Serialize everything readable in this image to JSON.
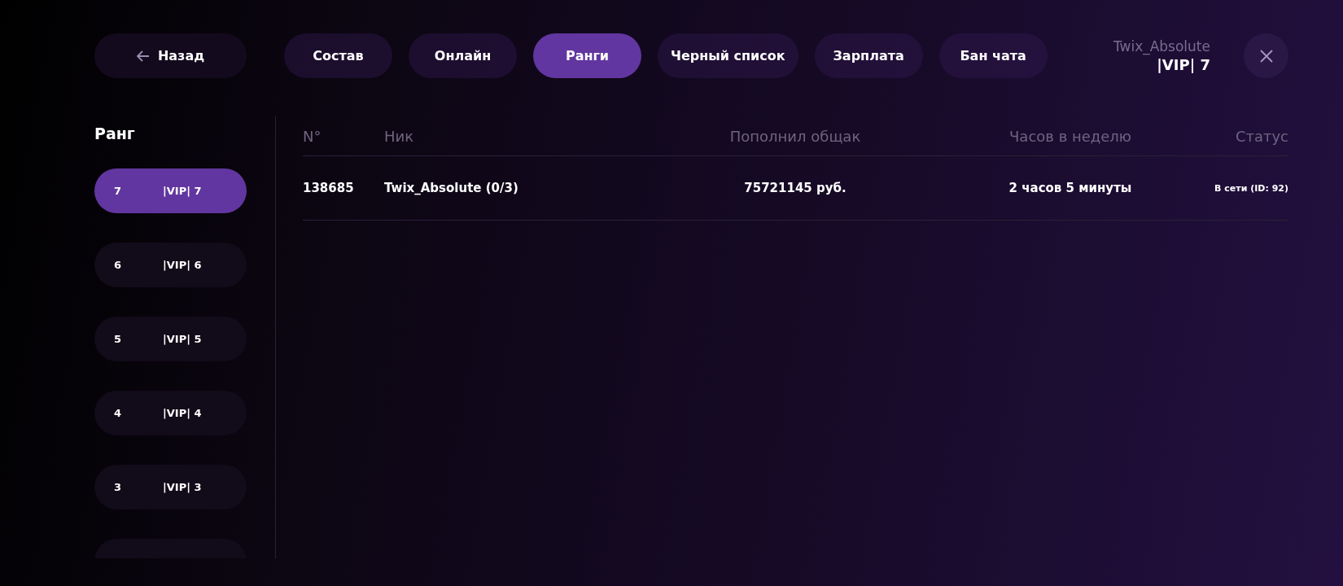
{
  "back_button": {
    "label": "Назад"
  },
  "tabs": [
    {
      "label": "Состав",
      "selected": false
    },
    {
      "label": "Онлайн",
      "selected": false
    },
    {
      "label": "Ранги",
      "selected": true
    },
    {
      "label": "Черный список",
      "selected": false
    },
    {
      "label": "Зарплата",
      "selected": false
    },
    {
      "label": "Бан чата",
      "selected": false
    }
  ],
  "user": {
    "name": "Twix_Absolute",
    "rank": "|VIP| 7"
  },
  "sidebar": {
    "title": "Ранг",
    "items": [
      {
        "number": "7",
        "name": "|VIP| 7",
        "selected": true
      },
      {
        "number": "6",
        "name": "|VIP| 6",
        "selected": false
      },
      {
        "number": "5",
        "name": "|VIP| 5",
        "selected": false
      },
      {
        "number": "4",
        "name": "|VIP| 4",
        "selected": false
      },
      {
        "number": "3",
        "name": "|VIP| 3",
        "selected": false
      },
      {
        "selected": false
      }
    ]
  },
  "table": {
    "columns": [
      "N°",
      "Ник",
      "Пополнил общак",
      "Часов в неделю",
      "Статус"
    ],
    "rows": [
      {
        "number": "138685",
        "nick": "Twix_Absolute (0/3)",
        "deposit": "75721145 руб.",
        "hours": "2 часов 5 минуты",
        "status": "В сети (ID: 92)"
      }
    ]
  }
}
